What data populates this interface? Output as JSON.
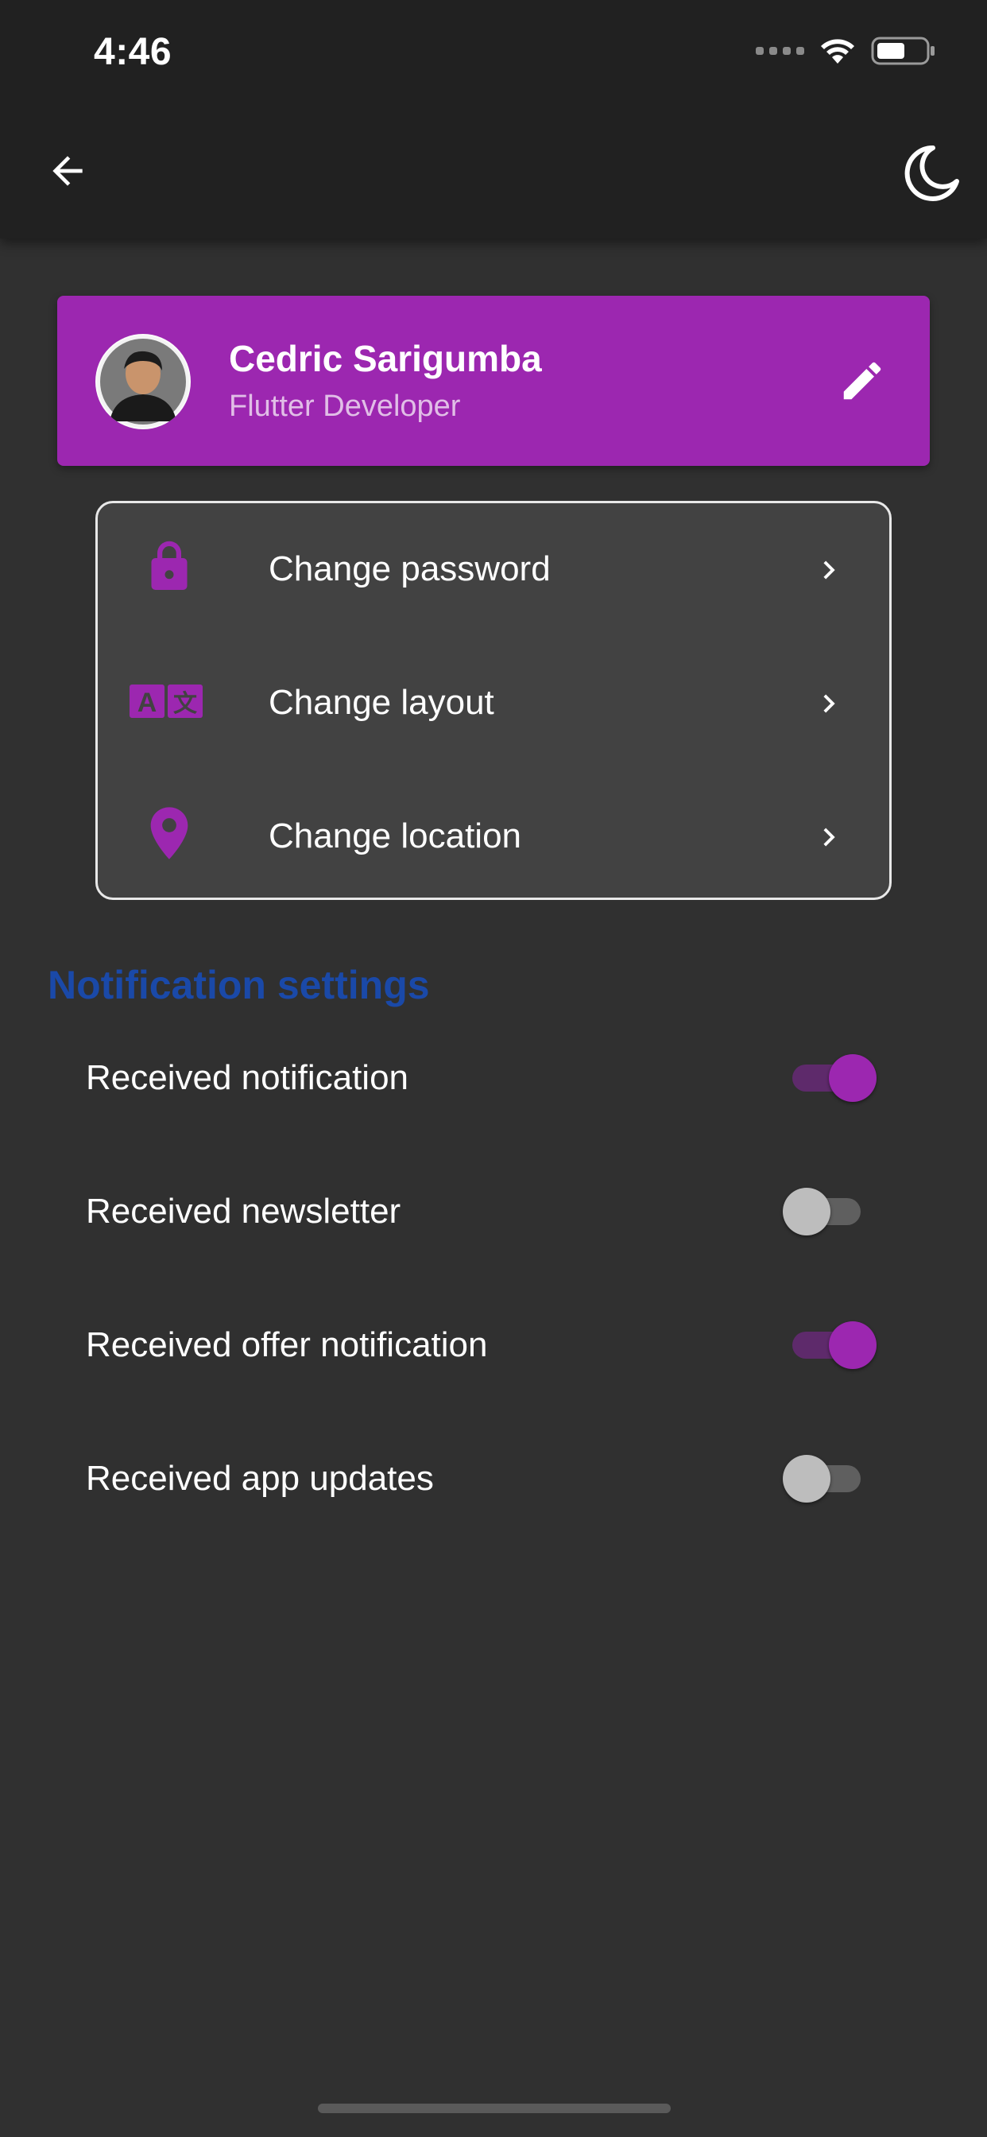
{
  "status_bar": {
    "time": "4:46"
  },
  "app_bar": {
    "back_icon": "arrow-back-icon",
    "theme_icon": "moon-icon"
  },
  "profile": {
    "name": "Cedric Sarigumba",
    "role": "Flutter Developer",
    "edit_icon": "pencil-icon",
    "card_color": "#9c27b0"
  },
  "options": [
    {
      "label": "Change password",
      "icon": "lock-icon"
    },
    {
      "label": "Change layout",
      "icon": "translate-icon"
    },
    {
      "label": "Change location",
      "icon": "location-pin-icon"
    }
  ],
  "notifications": {
    "title": "Notification settings",
    "items": [
      {
        "label": "Received notification",
        "enabled": true
      },
      {
        "label": "Received newsletter",
        "enabled": false
      },
      {
        "label": "Received offer notification",
        "enabled": true
      },
      {
        "label": "Received app updates",
        "enabled": false
      }
    ]
  },
  "colors": {
    "accent": "#9c27b0",
    "section_title": "#1a49a8",
    "background": "#303030",
    "app_bar": "#212121",
    "card": "#424242"
  }
}
